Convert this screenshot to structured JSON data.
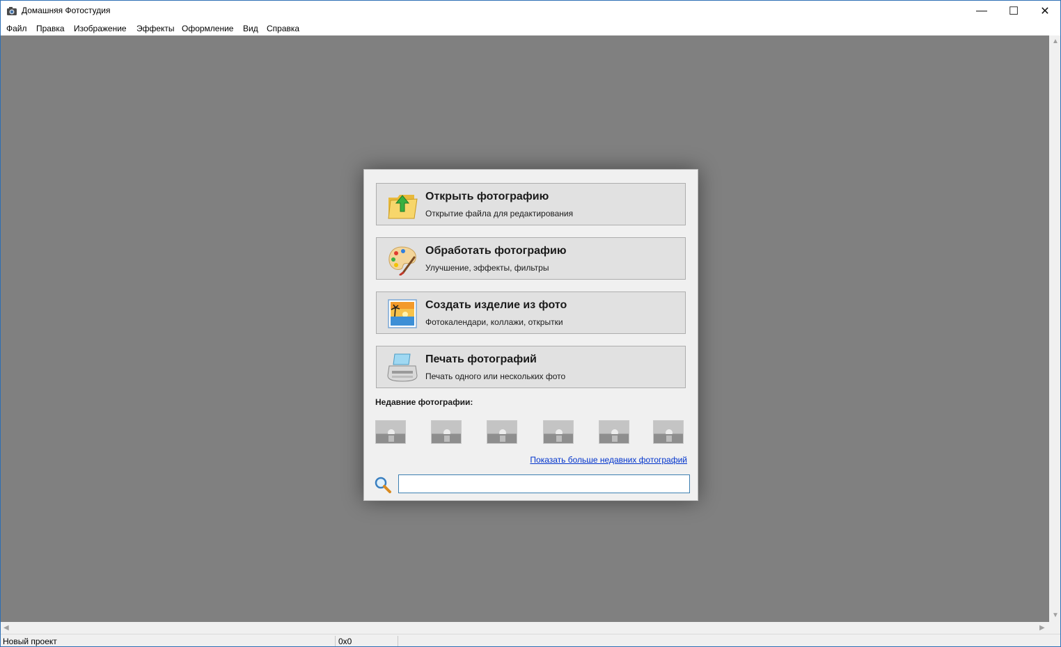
{
  "window": {
    "title": "Домашняя Фотостудия",
    "controls": {
      "minimize": "—",
      "maximize": "☐",
      "close": "✕"
    }
  },
  "menu": [
    "Файл",
    "Правка",
    "Изображение",
    "Эффекты",
    "Оформление",
    "Вид",
    "Справка"
  ],
  "dialog": {
    "actions": [
      {
        "title": "Открыть фотографию",
        "subtitle": "Открытие файла для редактирования",
        "icon": "folder-up-arrow-icon"
      },
      {
        "title": "Обработать фотографию",
        "subtitle": "Улучшение, эффекты, фильтры",
        "icon": "palette-icon"
      },
      {
        "title": "Создать изделие из фото",
        "subtitle": "Фотокалендари, коллажи, открытки",
        "icon": "photo-icon"
      },
      {
        "title": "Печать фотографий",
        "subtitle": "Печать одного или нескольких фото",
        "icon": "printer-icon"
      }
    ],
    "recent_title": "Недавние фотографии:",
    "recent_count": 6,
    "more_link": "Показать больше недавних фотографий",
    "search": {
      "value": "",
      "icon": "search-icon"
    }
  },
  "status": {
    "project": "Новый проект",
    "size": "0x0"
  },
  "colors": {
    "workspace": "#808080",
    "link": "#0033cc",
    "window_border": "#2d6fb5"
  }
}
